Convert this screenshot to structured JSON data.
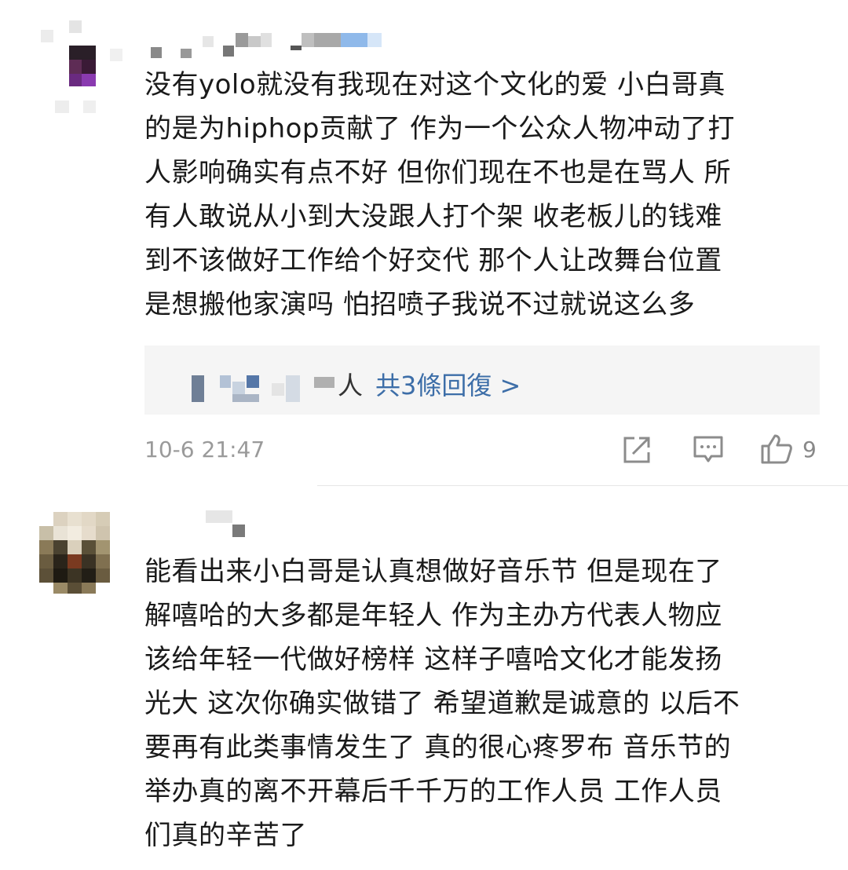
{
  "comments": [
    {
      "lines": [
        "没有yolo就没有我现在对这个文化的爱 小白哥真",
        "的是为hiphop贡献了 作为一个公众人物冲动了打",
        "人影响确实有点不好 但你们现在不也是在骂人 所",
        "有人敢说从小到大没跟人打个架 收老板儿的钱难",
        "到不该做好工作给个好交代 那个人让改舞台位置",
        "是想搬他家演吗 怕招喷子我说不过就说这么多"
      ],
      "replies": {
        "label_visible": "人",
        "count_text": "共3條回復 >"
      },
      "timestamp": "10-6 21:47",
      "like_count": "9",
      "actions": [
        "share-icon",
        "comment-icon",
        "like-icon"
      ]
    },
    {
      "lines": [
        "能看出来小白哥是认真想做好音乐节 但是现在了",
        "解嘻哈的大多都是年轻人 作为主办方代表人物应",
        "该给年轻一代做好榜样 这样子嘻哈文化才能发扬",
        "光大 这次你确实做错了 希望道歉是诚意的 以后不",
        "要再有此类事情发生了 真的很心疼罗布 音乐节的",
        "举办真的离不开幕后千千万的工作人员 工作人员",
        "们真的辛苦了"
      ]
    }
  ],
  "colors": {
    "link": "#3d6ea8",
    "meta": "#9a9a9a",
    "reply_bg": "#f5f5f5"
  }
}
